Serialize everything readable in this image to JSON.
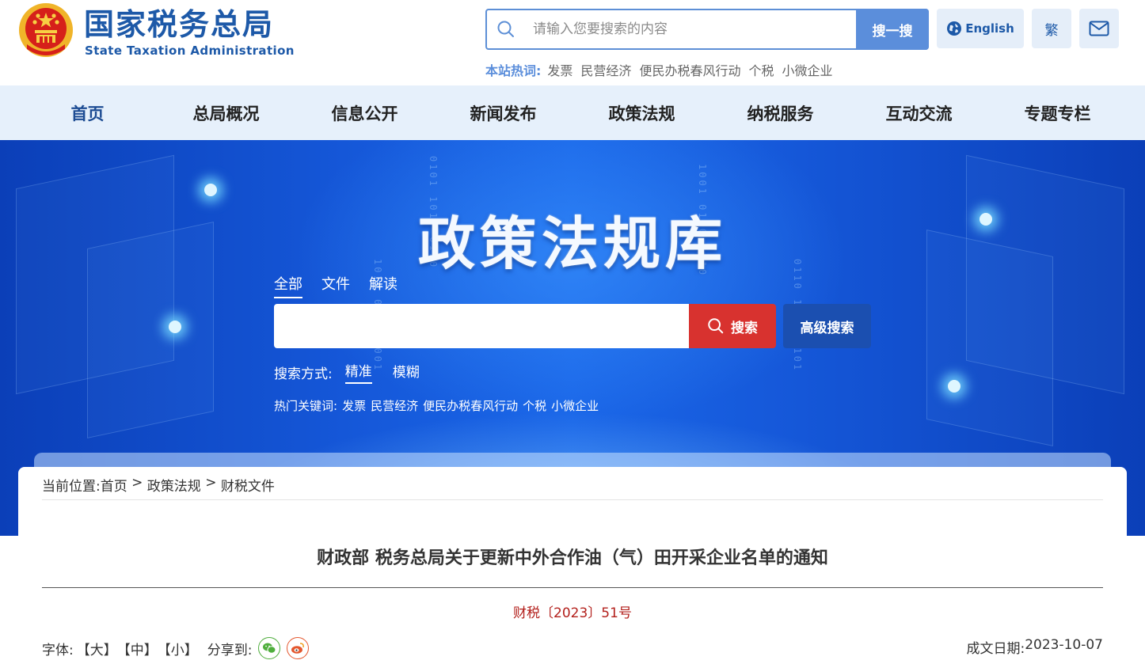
{
  "header": {
    "logo_cn": "国家税务总局",
    "logo_en": "State Taxation Administration",
    "search_placeholder": "请输入您要搜索的内容",
    "search_button": "搜一搜",
    "english_button": "English",
    "traditional_button": "繁",
    "hot_label": "本站热词:",
    "hot_keywords": [
      "发票",
      "民营经济",
      "便民办税春风行动",
      "个税",
      "小微企业"
    ]
  },
  "nav": {
    "items": [
      "首页",
      "总局概况",
      "信息公开",
      "新闻发布",
      "政策法规",
      "纳税服务",
      "互动交流",
      "专题专栏"
    ],
    "active_index": 0
  },
  "banner": {
    "title": "政策法规库",
    "tabs": [
      "全部",
      "文件",
      "解读"
    ],
    "search_button": "搜索",
    "advanced_button": "高级搜索",
    "mode_label": "搜索方式:",
    "mode_options": [
      "精准",
      "模糊"
    ],
    "hot_label": "热门关键词:",
    "hot_keywords": [
      "发票",
      "民营经济",
      "便民办税春风行动",
      "个税",
      "小微企业"
    ]
  },
  "content": {
    "breadcrumb_label": "当前位置:",
    "breadcrumb": [
      "首页",
      "政策法规",
      "财税文件"
    ],
    "breadcrumb_sep": " > ",
    "title": "财政部 税务总局关于更新中外合作油（气）田开采企业名单的通知",
    "doc_number": "财税〔2023〕51号",
    "font_label": "字体:",
    "font_sizes": [
      "【大】",
      "【中】",
      "【小】"
    ],
    "share_label": "分享到:",
    "date_label": "成文日期:",
    "date": "2023-10-07"
  },
  "colors": {
    "brand_blue": "#1d59a8",
    "nav_bg": "#e6f0fb",
    "search_red": "#d8322f",
    "advanced_blue": "#1b4fb0",
    "doc_number_red": "#b3201c"
  }
}
